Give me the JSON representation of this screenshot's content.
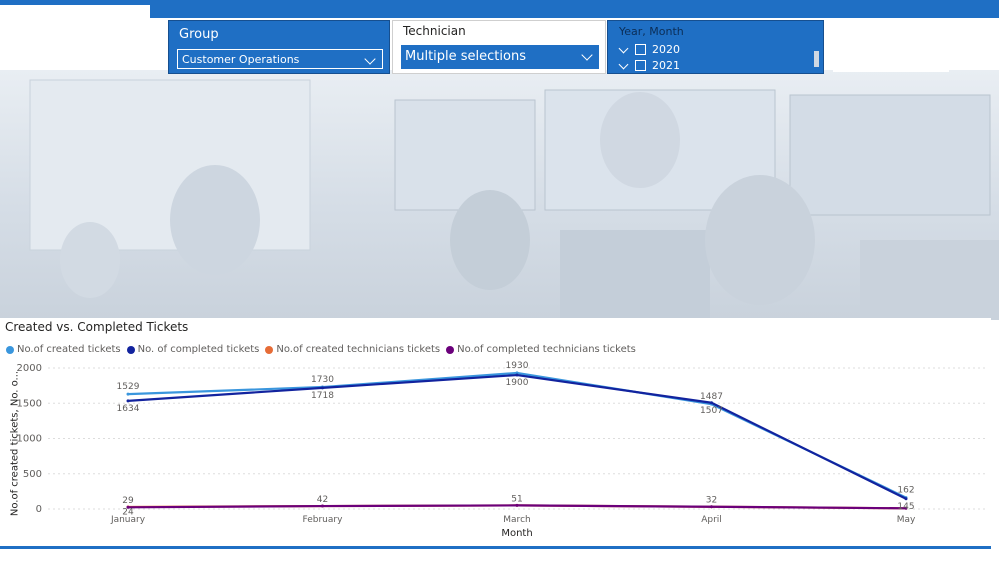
{
  "slicers": {
    "group": {
      "title": "Group",
      "value": "Customer Operations"
    },
    "technician": {
      "title": "Technician",
      "value": "Multiple selections"
    },
    "year_month": {
      "title": "Year, Month",
      "items": [
        "2020",
        "2021"
      ]
    }
  },
  "colors": {
    "accent": "#1f6fc4",
    "created": "#3a96dd",
    "completed": "#12239e",
    "created_tech": "#e66c37",
    "completed_tech": "#6b007b"
  },
  "chart_data": {
    "type": "line",
    "title": "Created vs. Completed Tickets",
    "xlabel": "Month",
    "ylabel": "No.of created tickets, No. o...",
    "categories": [
      "January",
      "February",
      "March",
      "April",
      "May"
    ],
    "ylim": [
      0,
      2000
    ],
    "yticks": [
      0,
      500,
      1000,
      1500,
      2000
    ],
    "grid": true,
    "legend_position": "top-left",
    "series": [
      {
        "name": "No.of created tickets",
        "color": "#3a96dd",
        "values": [
          1629,
          1730,
          1930,
          1487,
          162
        ]
      },
      {
        "name": "No. of completed tickets",
        "color": "#12239e",
        "values": [
          1534,
          1718,
          1900,
          1507,
          145
        ]
      },
      {
        "name": "No.of created technicians tickets",
        "color": "#e66c37",
        "values": [
          29,
          42,
          51,
          32,
          10
        ]
      },
      {
        "name": "No.of completed technicians tickets",
        "color": "#6b007b",
        "values": [
          24,
          42,
          51,
          32,
          10
        ]
      }
    ],
    "data_labels": [
      {
        "series": 0,
        "values": [
          "1529",
          "1730",
          "1930",
          "1487",
          "162"
        ]
      },
      {
        "series": 1,
        "values": [
          "1634",
          "1718",
          "1900",
          "1507",
          "145"
        ]
      },
      {
        "series": 2,
        "values": [
          "29",
          "42",
          "51",
          "32",
          ""
        ]
      },
      {
        "series": 3,
        "values": [
          "24",
          "",
          "",
          "",
          ""
        ]
      }
    ]
  }
}
